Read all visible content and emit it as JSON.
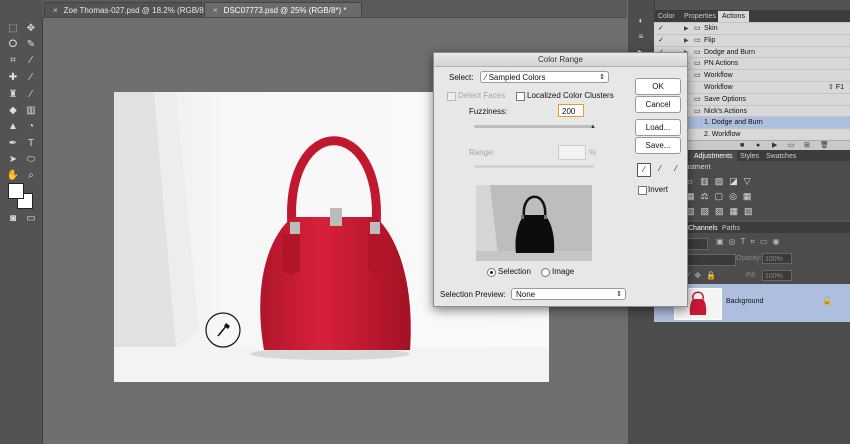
{
  "tabs": [
    {
      "name": "Zoe Thomas-027.psd @ 18.2% (RGB/8*) *"
    },
    {
      "name": "DSC07773.psd @ 25% (RGB/8*) *"
    }
  ],
  "panel_tabs": {
    "color": "Color",
    "properties": "Properties",
    "actions": "Actions"
  },
  "actions": [
    {
      "label": "Skin",
      "checked": true,
      "folder": true
    },
    {
      "label": "Flip",
      "checked": true,
      "folder": true
    },
    {
      "label": "Dodge and Burn",
      "checked": true,
      "folder": true
    },
    {
      "label": "PN Actions",
      "checked": true,
      "folder": true
    },
    {
      "label": "Workflow",
      "checked": true,
      "folder": true
    },
    {
      "label": "Workflow",
      "checked": true,
      "folder": false,
      "shortcut": "⇧ F1"
    },
    {
      "label": "Save Options",
      "checked": true,
      "folder": true
    },
    {
      "label": "Nick's Actions",
      "checked": true,
      "folder": true
    },
    {
      "label": "1. Dodge and Burn",
      "checked": true,
      "folder": false,
      "highlight": true
    },
    {
      "label": "2. Workflow",
      "checked": true,
      "folder": false
    }
  ],
  "adjust_tabs": {
    "adjustments": "Adjustments",
    "styles": "Styles",
    "swatches": "Swatches"
  },
  "adjust_heading": "justment",
  "layers_tabs": {
    "channels": "Channels",
    "paths": "Paths"
  },
  "layers": {
    "opacity_label": "Opacity:",
    "opacity_value": "100%",
    "fill_label": "Fill:",
    "fill_value": "100%",
    "layer_name": "Background"
  },
  "dialog": {
    "title": "Color Range",
    "select_label": "Select:",
    "select_value": "Sampled Colors",
    "detect_faces": "Detect Faces",
    "localized": "Localized Color Clusters",
    "fuzziness_label": "Fuzziness:",
    "fuzziness_value": "200",
    "range_label": "Range:",
    "range_unit": "%",
    "selection": "Selection",
    "image": "Image",
    "preview_label": "Selection Preview:",
    "preview_value": "None",
    "ok": "OK",
    "cancel": "Cancel",
    "load": "Load...",
    "save": "Save...",
    "invert": "Invert"
  }
}
